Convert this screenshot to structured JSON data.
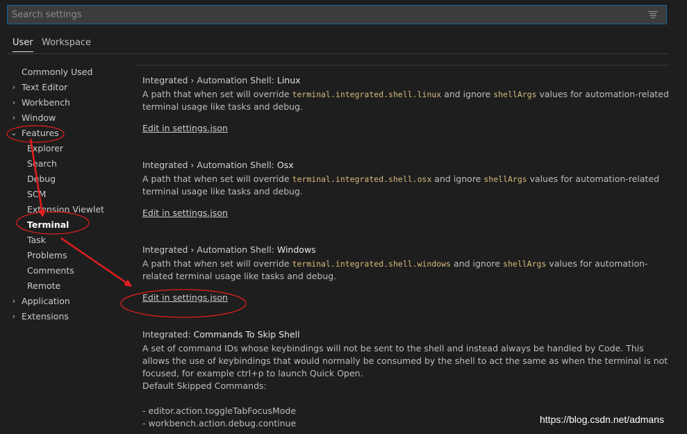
{
  "search": {
    "placeholder": "Search settings",
    "icon": "filter-icon"
  },
  "tabs": [
    {
      "label": "User"
    },
    {
      "label": "Workspace"
    }
  ],
  "toc": [
    {
      "label": "Commonly Used"
    },
    {
      "label": "Text Editor"
    },
    {
      "label": "Workbench"
    },
    {
      "label": "Window"
    },
    {
      "label": "Features"
    },
    {
      "label": "Explorer"
    },
    {
      "label": "Search"
    },
    {
      "label": "Debug"
    },
    {
      "label": "SCM"
    },
    {
      "label": "Extension Viewlet"
    },
    {
      "label": "Terminal"
    },
    {
      "label": "Task"
    },
    {
      "label": "Problems"
    },
    {
      "label": "Comments"
    },
    {
      "label": "Remote"
    },
    {
      "label": "Application"
    },
    {
      "label": "Extensions"
    }
  ],
  "settings": [
    {
      "prefix": "Integrated › Automation Shell: ",
      "key": "Linux",
      "desc_a": "A path that when set will override ",
      "code1": "terminal.integrated.shell.linux",
      "desc_b": " and ignore ",
      "code2": "shellArgs",
      "desc_c": " values for automation-related terminal usage like tasks and debug.",
      "link": "Edit in settings.json"
    },
    {
      "prefix": "Integrated › Automation Shell: ",
      "key": "Osx",
      "desc_a": "A path that when set will override ",
      "code1": "terminal.integrated.shell.osx",
      "desc_b": " and ignore ",
      "code2": "shellArgs",
      "desc_c": " values for automation-related terminal usage like tasks and debug.",
      "link": "Edit in settings.json"
    },
    {
      "prefix": "Integrated › Automation Shell: ",
      "key": "Windows",
      "desc_a": "A path that when set will override ",
      "code1": "terminal.integrated.shell.windows",
      "desc_b": " and ignore ",
      "code2": "shellArgs",
      "desc_c": " values for automation-related terminal usage like tasks and debug.",
      "link": "Edit in settings.json"
    }
  ],
  "skip_shell": {
    "prefix": "Integrated: ",
    "key": "Commands To Skip Shell",
    "desc": "A set of command IDs whose keybindings will not be sent to the shell and instead always be handled by Code. This allows the use of keybindings that would normally be consumed by the shell to act the same as when the terminal is not focused, for example ctrl+p to launch Quick Open.",
    "default_label": "Default Skipped Commands:",
    "commands": [
      "- editor.action.toggleTabFocusMode",
      "- workbench.action.debug.continue"
    ]
  },
  "watermark": "https://blog.csdn.net/admans",
  "colors": {
    "background": "#1e1e1e",
    "code": "#d7ba7d",
    "annotation": "#e51e1e",
    "focus_border": "#0e639c"
  }
}
